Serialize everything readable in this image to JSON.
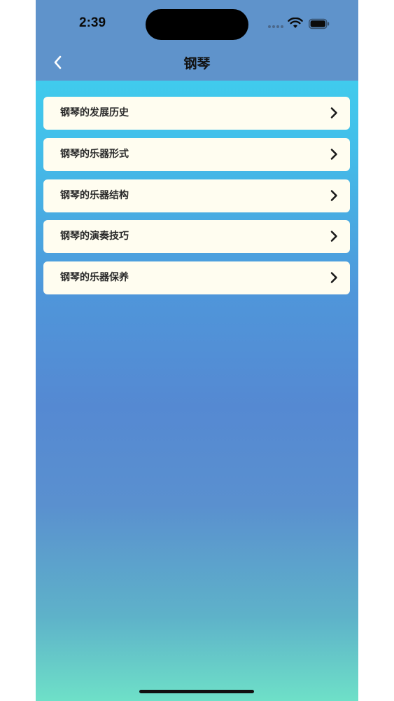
{
  "status_bar": {
    "time": "2:39"
  },
  "nav": {
    "title": "钢琴",
    "back_icon": "chevron-left-icon"
  },
  "menu": {
    "items": [
      {
        "label": "钢琴的发展历史"
      },
      {
        "label": "钢琴的乐器形式"
      },
      {
        "label": "钢琴的乐器结构"
      },
      {
        "label": "钢琴的演奏技巧"
      },
      {
        "label": "钢琴的乐器保养"
      }
    ],
    "item_icon": "chevron-right-icon"
  },
  "colors": {
    "header": "#5f93cb",
    "gradient_top": "#3ddcf2",
    "gradient_mid": "#5589d2",
    "gradient_bottom": "#6ee0c8",
    "card": "#fffdf0"
  }
}
